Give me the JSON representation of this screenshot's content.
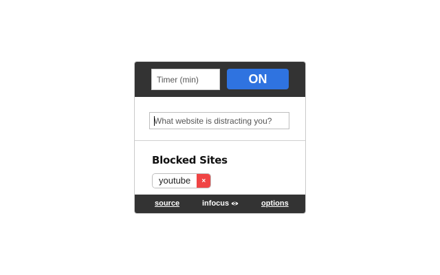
{
  "header": {
    "timer_placeholder": "Timer (min)",
    "toggle_label": "ON",
    "toggle_color": "#2f73e0"
  },
  "add_site": {
    "placeholder": "What website is distracting you?"
  },
  "blocked": {
    "title": "Blocked Sites",
    "sites": [
      {
        "label": "youtube",
        "remove_label": "×"
      }
    ],
    "remove_color": "#f04444"
  },
  "footer": {
    "source_label": "source",
    "brand_label": "infocus",
    "brand_icon": "eye-icon",
    "options_label": "options"
  }
}
